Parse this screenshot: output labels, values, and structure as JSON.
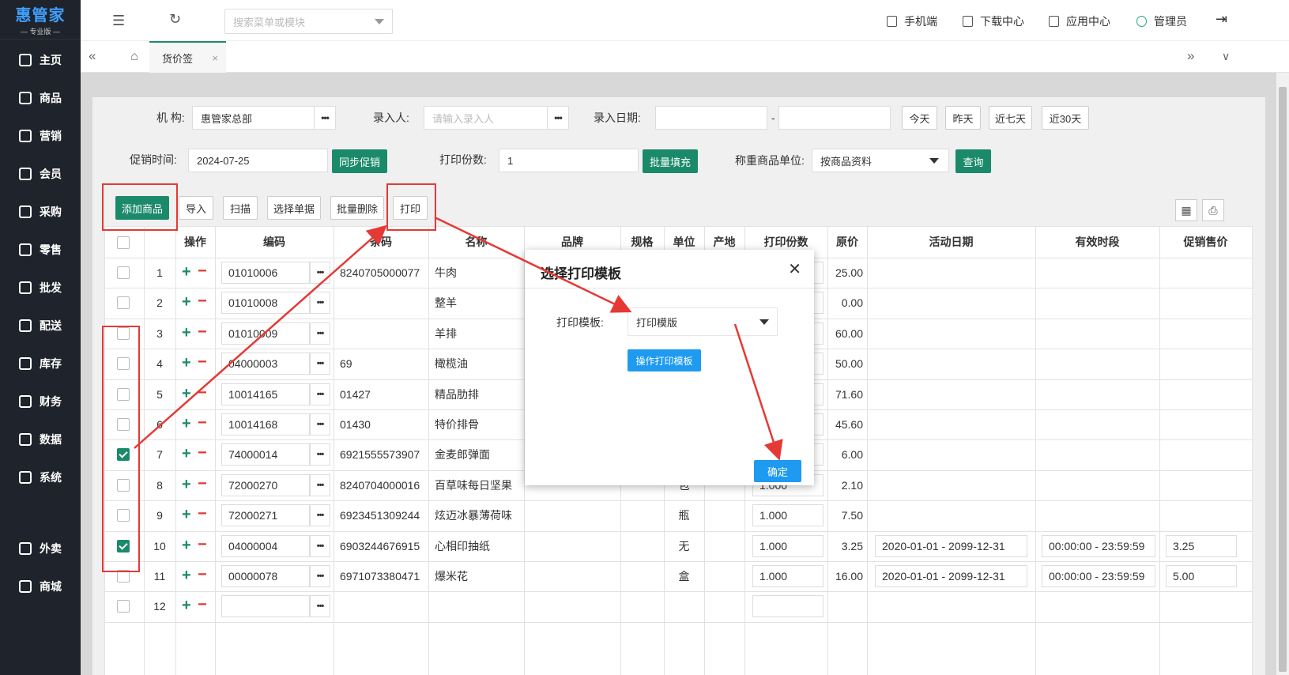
{
  "sidebar": {
    "brand": "惠管家",
    "edition": "— 专业版 —",
    "items": [
      {
        "label": "主页",
        "icon": "home-icon"
      },
      {
        "label": "商品",
        "icon": "cube-icon"
      },
      {
        "label": "营销",
        "icon": "chart-icon"
      },
      {
        "label": "会员",
        "icon": "diamond-icon"
      },
      {
        "label": "采购",
        "icon": "purchase-icon"
      },
      {
        "label": "零售",
        "icon": "bag-icon"
      },
      {
        "label": "批发",
        "icon": "building-icon"
      },
      {
        "label": "配送",
        "icon": "delivery-icon"
      },
      {
        "label": "库存",
        "icon": "warehouse-icon"
      },
      {
        "label": "财务",
        "icon": "finance-icon"
      },
      {
        "label": "数据",
        "icon": "data-icon"
      },
      {
        "label": "系统",
        "icon": "settings-icon"
      },
      {
        "label": "外卖",
        "icon": "bike-icon"
      },
      {
        "label": "商城",
        "icon": "shop-icon"
      }
    ]
  },
  "topbar": {
    "search_placeholder": "搜索菜单或模块",
    "mobile": "手机端",
    "download": "下载中心",
    "apps": "应用中心",
    "user": "管理员"
  },
  "tabs": {
    "active": "货价签"
  },
  "filters": {
    "org_label": "机 构:",
    "org_value": "惠管家总部",
    "entry_person_label": "录入人:",
    "entry_person_placeholder": "请输入录入人",
    "entry_date_label": "录入日期:",
    "date_sep": "-",
    "today": "今天",
    "yesterday": "昨天",
    "last7": "近七天",
    "last30": "近30天",
    "promo_time_label": "促销时间:",
    "promo_time_value": "2024-07-25",
    "sync_promo": "同步促销",
    "print_copies_label": "打印份数:",
    "print_copies_value": "1",
    "batch_fill": "批量填充",
    "weigh_unit_label": "称重商品单位:",
    "weigh_unit_value": "按商品资料",
    "query": "查询"
  },
  "toolbar": {
    "add_goods": "添加商品",
    "import": "导入",
    "scan": "扫描",
    "select_doc": "选择单据",
    "batch_delete": "批量删除",
    "print": "打印"
  },
  "table": {
    "headers": [
      "操作",
      "编码",
      "条码",
      "名称",
      "品牌",
      "规格",
      "单位",
      "产地",
      "打印份数",
      "原价",
      "活动日期",
      "有效时段",
      "促销售价"
    ],
    "rows": [
      {
        "no": "1",
        "code": "01010006",
        "barcode": "8240705000077",
        "name": "牛肉",
        "unit": "",
        "copies": "",
        "price": "25.00",
        "date": "",
        "period": "",
        "promo": "",
        "checked": false
      },
      {
        "no": "2",
        "code": "01010008",
        "barcode": "",
        "name": "整羊",
        "unit": "",
        "copies": "",
        "price": "0.00",
        "date": "",
        "period": "",
        "promo": "",
        "checked": false
      },
      {
        "no": "3",
        "code": "01010009",
        "barcode": "",
        "name": "羊排",
        "unit": "",
        "copies": "",
        "price": "60.00",
        "date": "",
        "period": "",
        "promo": "",
        "checked": false
      },
      {
        "no": "4",
        "code": "04000003",
        "barcode": "69",
        "name": "橄榄油",
        "unit": "",
        "copies": "",
        "price": "50.00",
        "date": "",
        "period": "",
        "promo": "",
        "checked": false
      },
      {
        "no": "5",
        "code": "10014165",
        "barcode": "01427",
        "name": "精品肋排",
        "unit": "",
        "copies": "",
        "price": "71.60",
        "date": "",
        "period": "",
        "promo": "",
        "checked": false
      },
      {
        "no": "6",
        "code": "10014168",
        "barcode": "01430",
        "name": "特价排骨",
        "unit": "",
        "copies": "",
        "price": "45.60",
        "date": "",
        "period": "",
        "promo": "",
        "checked": false
      },
      {
        "no": "7",
        "code": "74000014",
        "barcode": "6921555573907",
        "name": "金麦郎弹面",
        "unit": "",
        "copies": "",
        "price": "6.00",
        "date": "",
        "period": "",
        "promo": "",
        "checked": true
      },
      {
        "no": "8",
        "code": "72000270",
        "barcode": "8240704000016",
        "name": "百草味每日坚果",
        "unit": "包",
        "copies": "1.000",
        "price": "2.10",
        "date": "",
        "period": "",
        "promo": "",
        "checked": false
      },
      {
        "no": "9",
        "code": "72000271",
        "barcode": "6923451309244",
        "name": "炫迈冰暴薄荷味",
        "unit": "瓶",
        "copies": "1.000",
        "price": "7.50",
        "date": "",
        "period": "",
        "promo": "",
        "checked": false
      },
      {
        "no": "10",
        "code": "04000004",
        "barcode": "6903244676915",
        "name": "心相印抽纸",
        "unit": "无",
        "copies": "1.000",
        "price": "3.25",
        "date": "2020-01-01 - 2099-12-31",
        "period": "00:00:00 - 23:59:59",
        "promo": "3.25",
        "checked": true
      },
      {
        "no": "11",
        "code": "00000078",
        "barcode": "6971073380471",
        "name": "爆米花",
        "unit": "盒",
        "copies": "1.000",
        "price": "16.00",
        "date": "2020-01-01 - 2099-12-31",
        "period": "00:00:00 - 23:59:59",
        "promo": "5.00",
        "checked": false
      },
      {
        "no": "12",
        "code": "",
        "barcode": "",
        "name": "",
        "unit": "",
        "copies": "",
        "price": "",
        "date": "",
        "period": "",
        "promo": "",
        "checked": false
      }
    ]
  },
  "modal": {
    "title": "选择打印模板",
    "template_label": "打印模板:",
    "template_value": "打印模版",
    "manage_templates": "操作打印模板",
    "confirm": "确定"
  },
  "colors": {
    "accent_green": "#1b8a6b",
    "confirm_blue": "#1e9bf0",
    "annotation_red": "#e53935"
  }
}
